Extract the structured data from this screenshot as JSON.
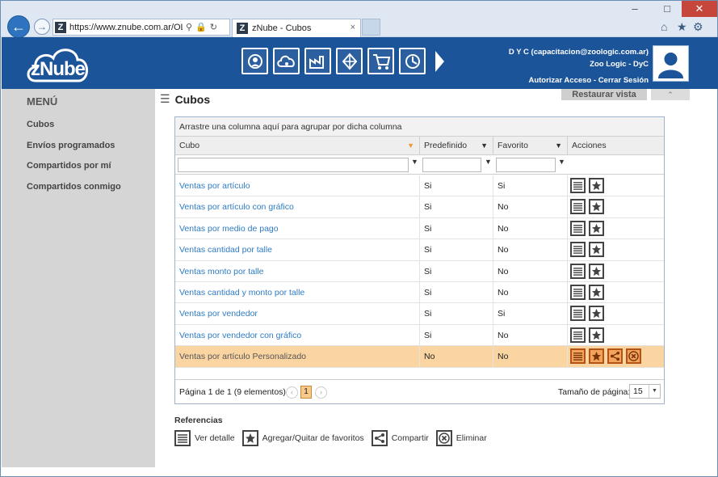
{
  "browser": {
    "url": "https://www.znube.com.ar/OLAP,",
    "tab_title": "zNube - Cubos",
    "tab_close": "×"
  },
  "app": {
    "brand": "zNube",
    "user_line1": "D Y C (capacitacion@zoologic.com.ar)",
    "user_line2": "Zoo Logic - DyC",
    "authorize_access": "Autorizar Acceso",
    "separator": "-",
    "logout": "Cerrar Sesión"
  },
  "sidebar": {
    "title": "MENÚ",
    "items": [
      {
        "label": "Cubos"
      },
      {
        "label": "Envíos programados"
      },
      {
        "label": "Compartidos por mí"
      },
      {
        "label": "Compartidos conmigo"
      }
    ]
  },
  "page": {
    "title": "Cubos",
    "restore_label": "Restaurar vista"
  },
  "grid": {
    "group_hint": "Arrastre una columna aquí para agrupar por dicha columna",
    "columns": [
      "Cubo",
      "Predefinido",
      "Favorito",
      "Acciones"
    ],
    "rows": [
      {
        "cubo": "Ventas por artículo",
        "predefinido": "Si",
        "favorito": "Si",
        "custom": false
      },
      {
        "cubo": "Ventas por artículo con gráfico",
        "predefinido": "Si",
        "favorito": "No",
        "custom": false
      },
      {
        "cubo": "Ventas por medio de pago",
        "predefinido": "Si",
        "favorito": "No",
        "custom": false
      },
      {
        "cubo": "Ventas cantidad por talle",
        "predefinido": "Si",
        "favorito": "No",
        "custom": false
      },
      {
        "cubo": "Ventas monto por talle",
        "predefinido": "Si",
        "favorito": "No",
        "custom": false
      },
      {
        "cubo": "Ventas cantidad y monto por talle",
        "predefinido": "Si",
        "favorito": "No",
        "custom": false
      },
      {
        "cubo": "Ventas por vendedor",
        "predefinido": "Si",
        "favorito": "Si",
        "custom": false
      },
      {
        "cubo": "Ventas por vendedor con gráfico",
        "predefinido": "Si",
        "favorito": "No",
        "custom": false
      },
      {
        "cubo": "Ventas por artículo Personalizado",
        "predefinido": "No",
        "favorito": "No",
        "custom": true
      }
    ],
    "pager_info": "Página 1 de 1 (9 elementos)",
    "current_page": "1",
    "page_size_label": "Tamaño de página:",
    "page_size": "15"
  },
  "references": {
    "title": "Referencias",
    "items": [
      {
        "icon": "list-icon",
        "label": "Ver detalle"
      },
      {
        "icon": "star-icon",
        "label": "Agregar/Quitar de favoritos"
      },
      {
        "icon": "share-icon",
        "label": "Compartir"
      },
      {
        "icon": "delete-icon",
        "label": "Eliminar"
      }
    ]
  },
  "colors": {
    "header": "#1b5499",
    "selected_row": "#fad5a2",
    "link": "#2e7bc4"
  }
}
